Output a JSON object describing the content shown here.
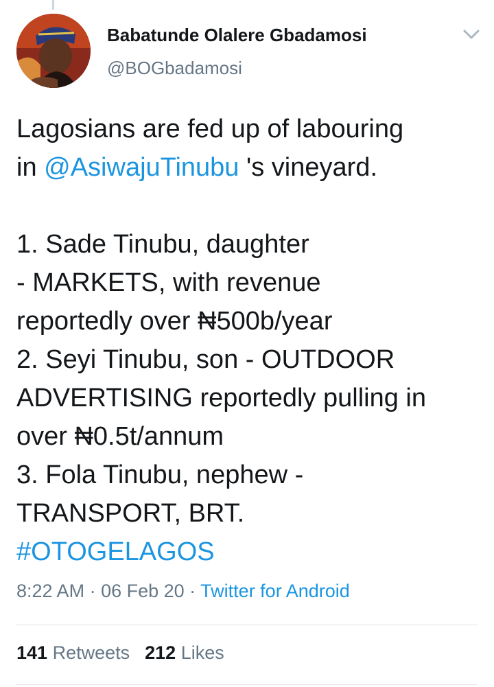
{
  "tweet": {
    "author": {
      "display_name": "Babatunde Olalere Gbadamosi",
      "handle": "@BOGbadamosi"
    },
    "menu_icon": "chevron-down-icon",
    "text": {
      "line1": "Lagosians are fed up of labouring",
      "line2_prefix": "in ",
      "mention": "@AsiwajuTinubu",
      "line2_suffix": " 's vineyard.",
      "line3": "1. Sade Tinubu, daughter",
      "line4": "- MARKETS, with revenue",
      "line5": "reportedly  over ₦500b/year",
      "line6": "2. Seyi Tinubu, son - OUTDOOR",
      "line7": "ADVERTISING reportedly pulling in",
      "line8": "over ₦0.5t/annum",
      "line9": "3. Fola Tinubu, nephew -",
      "line10": "TRANSPORT, BRT.",
      "hashtag": "#OTOGELAGOS"
    },
    "meta": {
      "time": "8:22 AM",
      "separator1": " · ",
      "date": "06 Feb 20",
      "separator2": " · ",
      "source": "Twitter for Android"
    },
    "stats": {
      "retweets_count": "141",
      "retweets_label": "Retweets",
      "likes_count": "212",
      "likes_label": "Likes"
    },
    "colors": {
      "link": "#1b95e0",
      "secondary_text": "#657786",
      "primary_text": "#14171a",
      "divider": "#e1e8ed"
    }
  }
}
